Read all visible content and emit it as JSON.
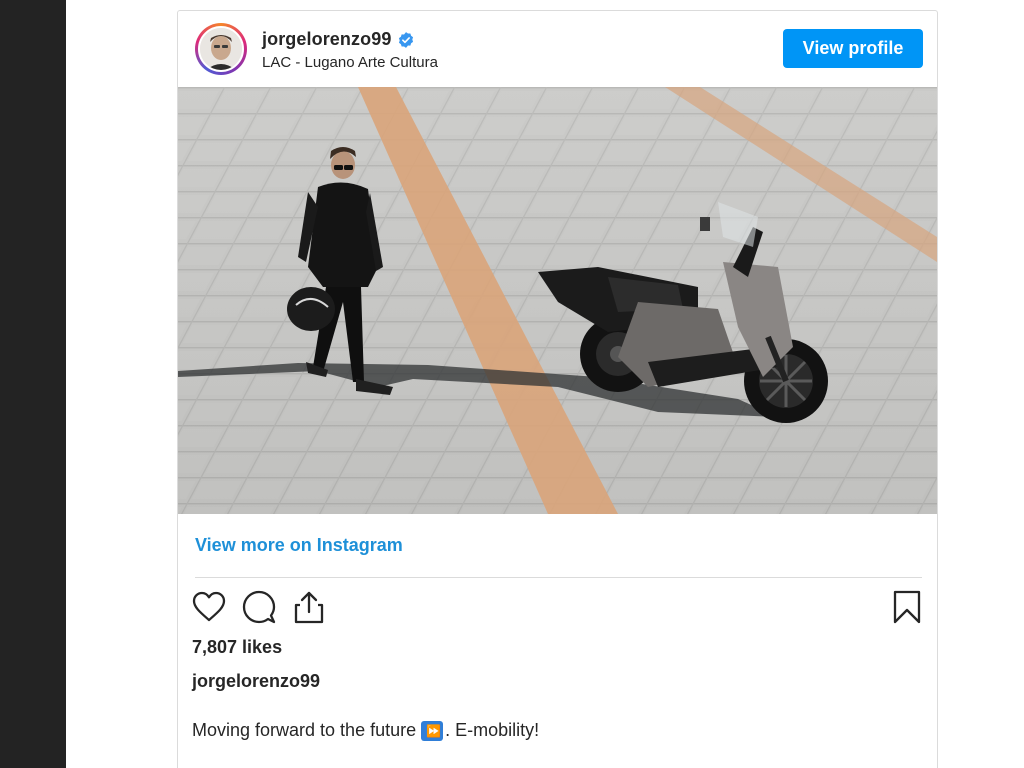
{
  "post": {
    "username": "jorgelorenzo99",
    "location": "LAC - Lugano Arte Cultura",
    "view_profile_label": "View profile",
    "view_more_label": "View more on Instagram",
    "likes": "7,807 likes",
    "caption_user": "jorgelorenzo99",
    "caption_text_before": "Moving forward to the future",
    "caption_emoji": "⏩",
    "caption_text_after": ". E-mobility!"
  },
  "icons": {
    "verified": "verified-badge-icon",
    "like": "heart-icon",
    "comment": "comment-icon",
    "share": "share-icon",
    "save": "bookmark-icon"
  },
  "colors": {
    "accent": "#0095f6",
    "link": "#1e90d8",
    "sidebar": "#232323",
    "text": "#262626"
  }
}
